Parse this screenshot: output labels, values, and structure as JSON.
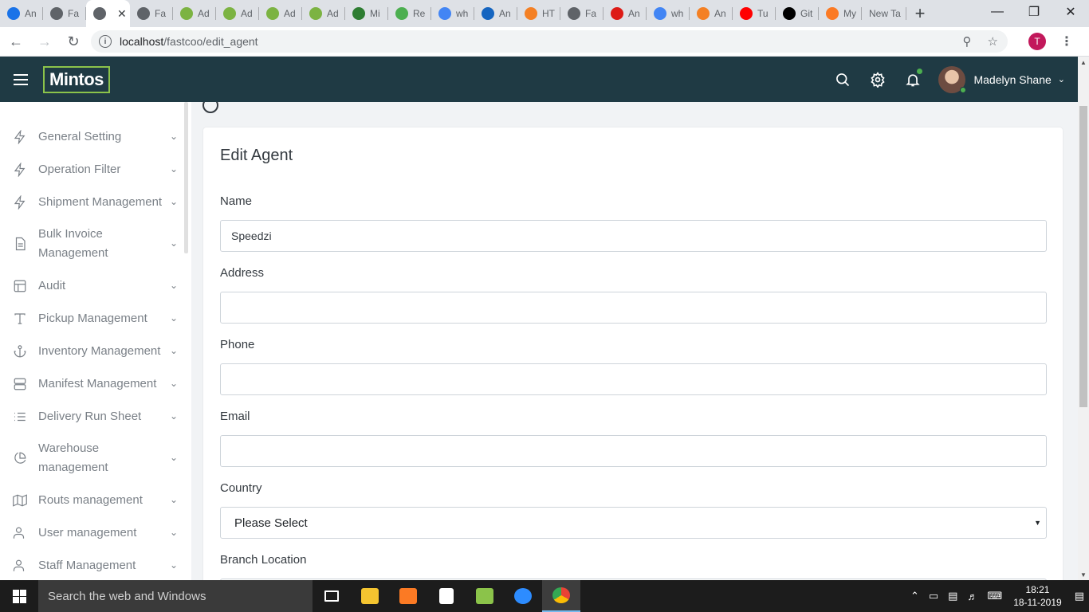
{
  "browser": {
    "tabs": [
      {
        "favicon": "24-icon",
        "title": "An",
        "color": "#1a73e8"
      },
      {
        "favicon": "globe-icon",
        "title": "Fa",
        "color": "#5f6368"
      },
      {
        "favicon": "globe-icon",
        "title": "",
        "color": "#5f6368",
        "active": true
      },
      {
        "favicon": "globe-icon",
        "title": "Fa",
        "color": "#5f6368"
      },
      {
        "favicon": "chart-icon",
        "title": "Ad",
        "color": "#7cb342"
      },
      {
        "favicon": "chart-icon",
        "title": "Ad",
        "color": "#7cb342"
      },
      {
        "favicon": "chart-icon",
        "title": "Ad",
        "color": "#7cb342"
      },
      {
        "favicon": "chart-icon",
        "title": "Ad",
        "color": "#7cb342"
      },
      {
        "favicon": "m-icon",
        "title": "Mi",
        "color": "#2e7d32"
      },
      {
        "favicon": "w3-icon",
        "title": "Re",
        "color": "#4caf50"
      },
      {
        "favicon": "google-icon",
        "title": "wh",
        "color": "#4285f4"
      },
      {
        "favicon": "gear-icon",
        "title": "An",
        "color": "#1565c0"
      },
      {
        "favicon": "stack-icon",
        "title": "HT",
        "color": "#f48024"
      },
      {
        "favicon": "globe-icon",
        "title": "Fa",
        "color": "#5f6368"
      },
      {
        "favicon": "angular-icon",
        "title": "An",
        "color": "#dd1b16"
      },
      {
        "favicon": "google-icon",
        "title": "wh",
        "color": "#4285f4"
      },
      {
        "favicon": "stack-icon",
        "title": "An",
        "color": "#f48024"
      },
      {
        "favicon": "youtube-icon",
        "title": "Tu",
        "color": "#ff0000"
      },
      {
        "favicon": "github-icon",
        "title": "Git",
        "color": "#000000"
      },
      {
        "favicon": "xampp-icon",
        "title": "My",
        "color": "#fb7a24"
      },
      {
        "favicon": "",
        "title": "New Ta",
        "color": "#5f6368"
      }
    ],
    "url_host": "localhost",
    "url_path": "/fastcoo/edit_agent",
    "profile_initial": "T"
  },
  "header": {
    "logo": "Mintos",
    "user_name": "Madelyn Shane"
  },
  "sidebar": {
    "items": [
      {
        "label": "General Setting",
        "icon": "bolt-icon"
      },
      {
        "label": "Operation Filter",
        "icon": "bolt-icon"
      },
      {
        "label": "Shipment Management",
        "icon": "bolt-icon"
      },
      {
        "label": "Bulk Invoice Management",
        "icon": "file-icon"
      },
      {
        "label": "Audit",
        "icon": "layout-icon"
      },
      {
        "label": "Pickup Management",
        "icon": "type-icon"
      },
      {
        "label": "Inventory Management",
        "icon": "anchor-icon"
      },
      {
        "label": "Manifest Management",
        "icon": "server-icon"
      },
      {
        "label": "Delivery Run Sheet",
        "icon": "list-icon"
      },
      {
        "label": "Warehouse management",
        "icon": "pie-chart-icon"
      },
      {
        "label": "Routs management",
        "icon": "map-icon"
      },
      {
        "label": "User management",
        "icon": "user-icon"
      },
      {
        "label": "Staff Management",
        "icon": "user-icon"
      }
    ]
  },
  "form": {
    "title": "Edit Agent",
    "name_label": "Name",
    "name_value": "Speedzi",
    "address_label": "Address",
    "address_value": "",
    "phone_label": "Phone",
    "phone_value": "",
    "email_label": "Email",
    "email_value": "",
    "country_label": "Country",
    "country_value": "Please Select",
    "branch_label": "Branch Location"
  },
  "taskbar": {
    "search_placeholder": "Search the web and Windows",
    "time": "18:21",
    "date": "18-11-2019"
  }
}
